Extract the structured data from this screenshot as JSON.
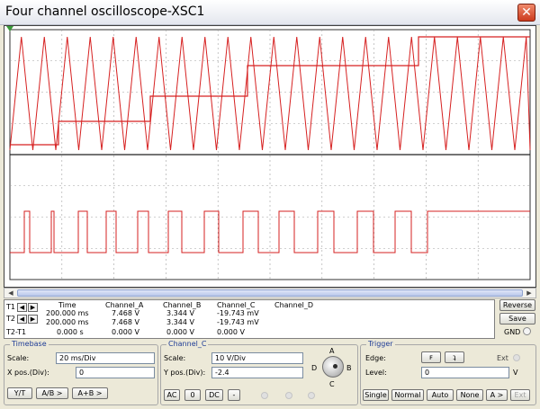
{
  "window": {
    "title": "Four channel oscilloscope-XSC1",
    "close": "✕"
  },
  "readout": {
    "headers": {
      "time": "Time",
      "a": "Channel_A",
      "b": "Channel_B",
      "c": "Channel_C",
      "d": "Channel_D"
    },
    "rows": [
      {
        "label": "T1",
        "time": "200.000 ms",
        "a": "7.468 V",
        "b": "3.344 V",
        "c": "-19.743 mV",
        "d": ""
      },
      {
        "label": "T2",
        "time": "200.000 ms",
        "a": "7.468 V",
        "b": "3.344 V",
        "c": "-19.743 mV",
        "d": ""
      },
      {
        "label": "T2-T1",
        "time": "0.000 s",
        "a": "0.000 V",
        "b": "0.000 V",
        "c": "0.000 V",
        "d": ""
      }
    ]
  },
  "side": {
    "reverse": "Reverse",
    "save": "Save",
    "gnd": "GND"
  },
  "timebase": {
    "title": "Timebase",
    "scale_label": "Scale:",
    "scale": "20 ms/Div",
    "xpos_label": "X pos.(Div):",
    "xpos": "0",
    "buttons": [
      "Y/T",
      "A/B >",
      "A+B >"
    ]
  },
  "channel": {
    "title": "Channel_C",
    "scale_label": "Scale:",
    "scale": "10  V/Div",
    "ypos_label": "Y pos.(Div):",
    "ypos": "-2.4",
    "buttons": [
      "AC",
      "0",
      "DC",
      "-"
    ],
    "knob": {
      "a": "A",
      "b": "B",
      "c": "C",
      "d": "D"
    }
  },
  "trigger": {
    "title": "Trigger",
    "edge_label": "Edge:",
    "edge_rise": "ꜰ",
    "edge_fall": "ʇ",
    "ext_label": "Ext",
    "level_label": "Level:",
    "level": "0",
    "level_unit": "V",
    "buttons": [
      "Single",
      "Normal",
      "Auto",
      "None",
      "A >",
      "Ext"
    ]
  },
  "colors": {
    "trace": "#d62020",
    "grid": "#a0a0a0",
    "screen_bg": "#ffffff"
  }
}
